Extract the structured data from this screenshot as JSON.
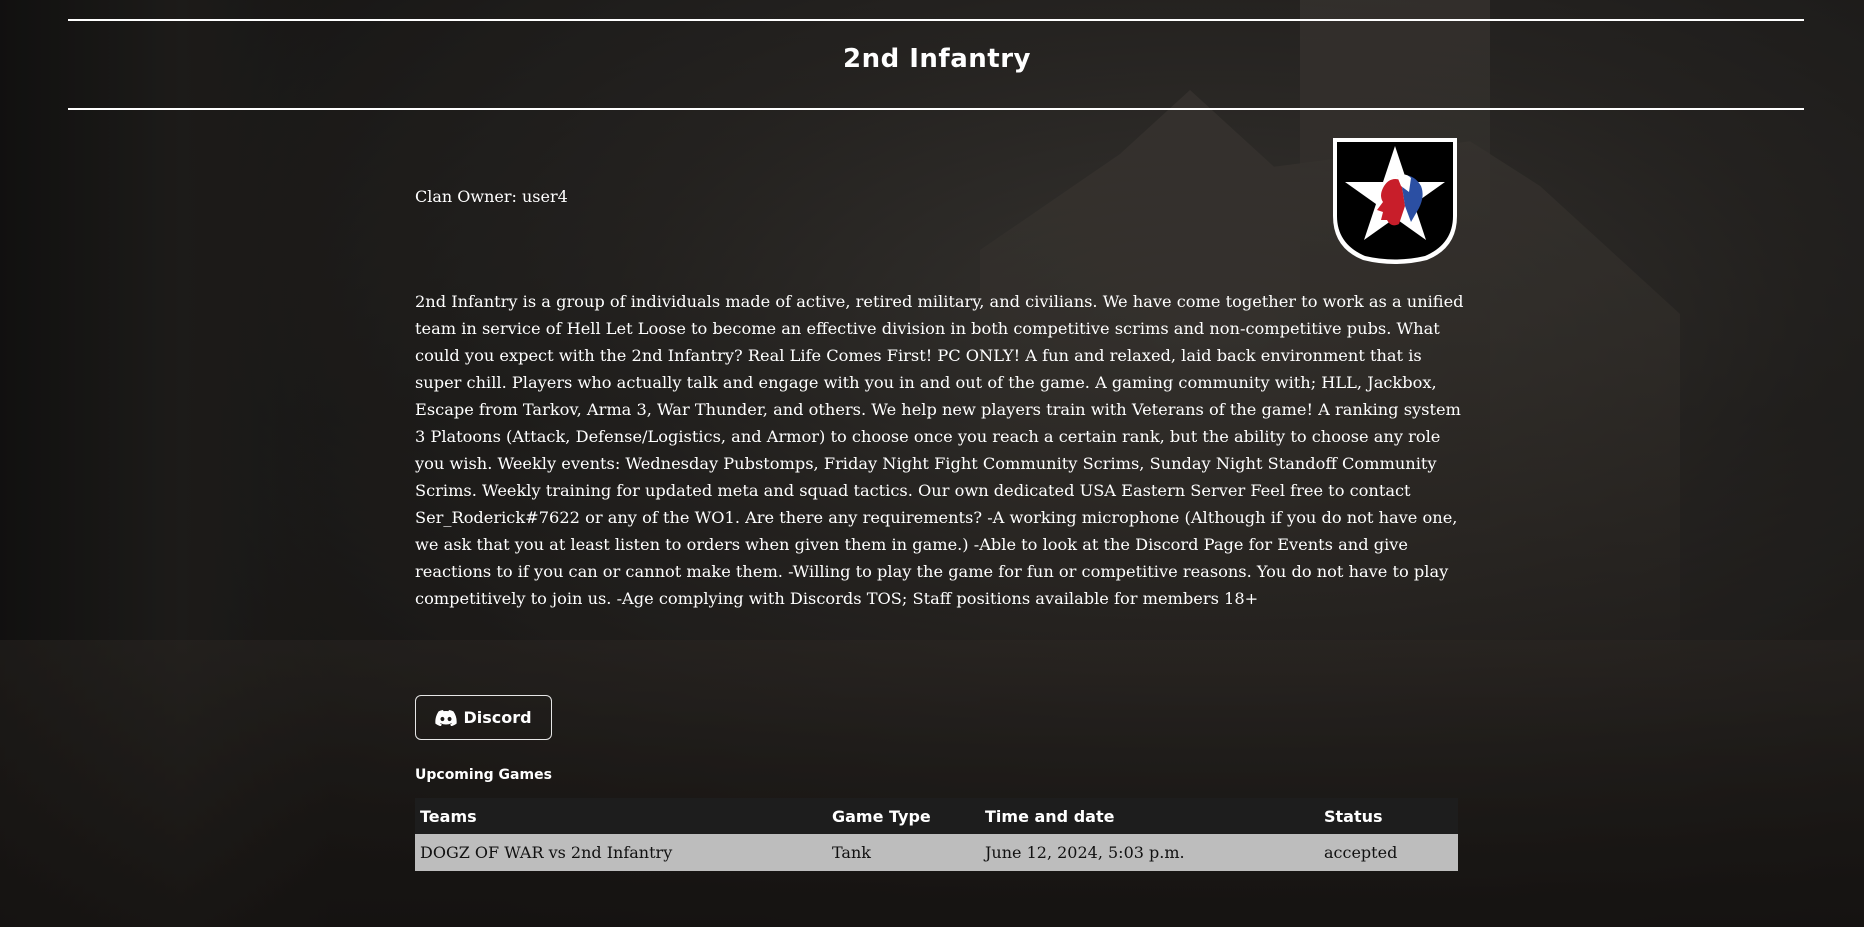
{
  "header": {
    "title": "2nd Infantry"
  },
  "clan": {
    "owner_label": "Clan Owner: user4",
    "description": "2nd Infantry is a group of individuals made of active, retired military, and civilians. We have come together to work as a unified team in service of Hell Let Loose to become an effective division in both competitive scrims and non-competitive pubs. What could you expect with the 2nd Infantry? Real Life Comes First! PC ONLY! A fun and relaxed, laid back environment that is super chill. Players who actually talk and engage with you in and out of the game. A gaming community with; HLL, Jackbox, Escape from Tarkov, Arma 3, War Thunder, and others. We help new players train with Veterans of the game! A ranking system 3 Platoons (Attack, Defense/Logistics, and Armor) to choose once you reach a certain rank, but the ability to choose any role you wish. Weekly events: Wednesday Pubstomps, Friday Night Fight Community Scrims, Sunday Night Standoff Community Scrims. Weekly training for updated meta and squad tactics. Our own dedicated USA Eastern Server Feel free to contact Ser_Roderick#7622 or any of the WO1. Are there any requirements? -A working microphone (Although if you do not have one, we ask that you at least listen to orders when given them in game.) -Able to look at the Discord Page for Events and give reactions to if you can or cannot make them. -Willing to play the game for fun or competitive reasons. You do not have to play competitively to join us. -Age complying with Discords TOS; Staff positions available for members 18+",
    "logo_icon": "star-shield-logo"
  },
  "discord": {
    "label": "Discord",
    "icon": "discord-icon"
  },
  "upcoming": {
    "title": "Upcoming Games",
    "columns": [
      "Teams",
      "Game Type",
      "Time and date",
      "Status"
    ],
    "rows": [
      {
        "teams": "DOGZ OF WAR vs 2nd Infantry",
        "game_type": "Tank",
        "time_date": "June 12, 2024, 5:03 p.m.",
        "status": "accepted"
      }
    ]
  },
  "colors": {
    "header_row": "#1d1d1d",
    "data_row": "#bdbdbd",
    "text": "#ffffff"
  }
}
